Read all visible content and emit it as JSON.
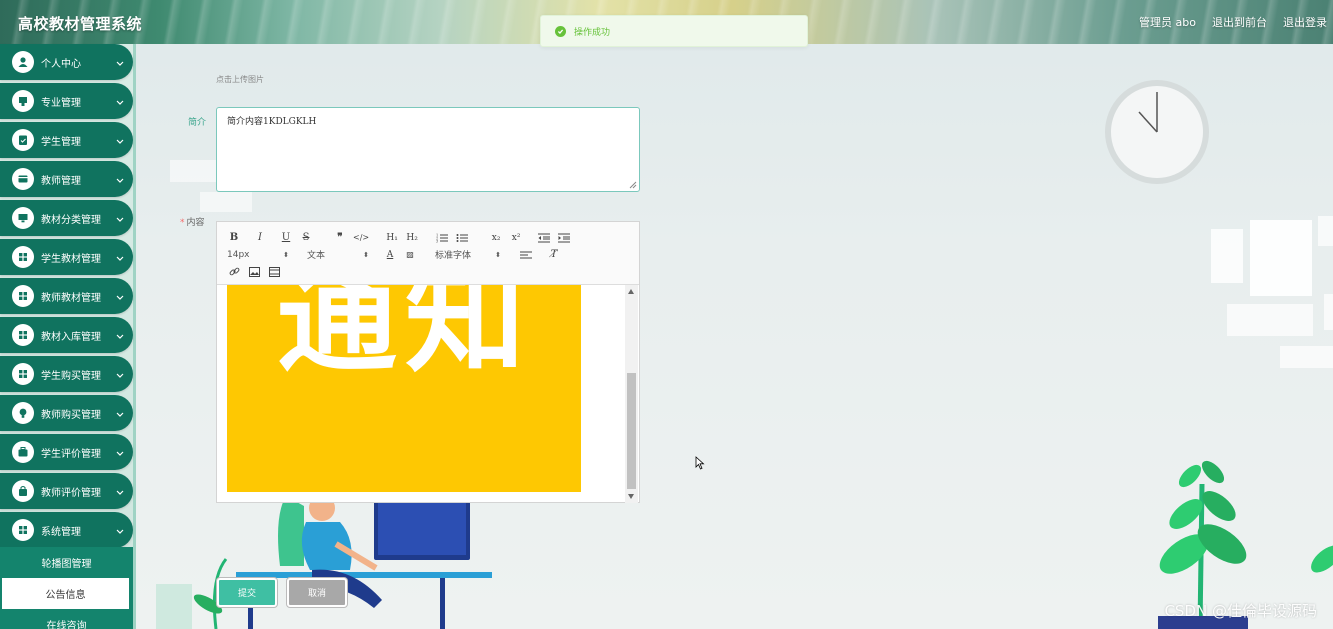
{
  "header": {
    "title": "高校教材管理系统",
    "links": [
      "管理员 abo",
      "退出到前台",
      "退出登录"
    ]
  },
  "toast": {
    "message": "操作成功"
  },
  "sidebar": {
    "items": [
      {
        "label": "个人中心",
        "icon": "user-icon"
      },
      {
        "label": "专业管理",
        "icon": "tag-icon"
      },
      {
        "label": "学生管理",
        "icon": "clipboard-icon"
      },
      {
        "label": "教师管理",
        "icon": "card-icon"
      },
      {
        "label": "教材分类管理",
        "icon": "monitor-icon"
      },
      {
        "label": "学生教材管理",
        "icon": "grid-icon"
      },
      {
        "label": "教师教材管理",
        "icon": "grid-icon"
      },
      {
        "label": "教材入库管理",
        "icon": "grid-icon"
      },
      {
        "label": "学生购买管理",
        "icon": "grid-icon"
      },
      {
        "label": "教师购买管理",
        "icon": "bulb-icon"
      },
      {
        "label": "学生评价管理",
        "icon": "briefcase-icon"
      },
      {
        "label": "教师评价管理",
        "icon": "bag-icon"
      },
      {
        "label": "系统管理",
        "icon": "grid-icon"
      }
    ],
    "submenu": [
      "轮播图管理",
      "公告信息",
      "在线咨询"
    ],
    "active_submenu": "公告信息"
  },
  "form": {
    "upload_hint": "点击上传图片",
    "intro_label": "简介",
    "intro_value": "简介内容1KDLGKLH",
    "content_label": "内容",
    "editor": {
      "font_size": "14px",
      "text_type": "文本",
      "font_family": "标准字体",
      "image_text": "通知"
    },
    "submit_label": "提交",
    "cancel_label": "取消"
  },
  "watermark": "CSDN @佳倫毕设源码",
  "colors": {
    "sidebar_item": "#10735f",
    "accent": "#3fbfa3",
    "image_bg": "#fec802"
  }
}
